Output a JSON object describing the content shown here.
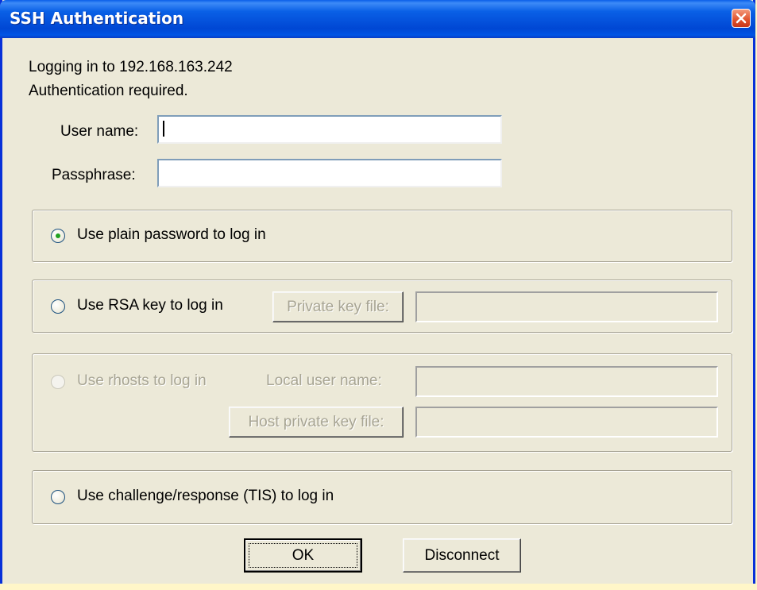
{
  "window": {
    "title": "SSH Authentication",
    "close_icon": "close-icon"
  },
  "info": {
    "line1": "Logging in to 192.168.163.242",
    "line2": "Authentication required."
  },
  "fields": {
    "username_label": "User name:",
    "username_value": "",
    "passphrase_label": "Passphrase:",
    "passphrase_value": ""
  },
  "options": {
    "plain_password": {
      "label": "Use plain password to log in",
      "selected": true,
      "enabled": true
    },
    "rsa": {
      "label": "Use RSA key to log in",
      "selected": false,
      "enabled": true,
      "button_label": "Private key file:",
      "file_value": ""
    },
    "rhosts": {
      "label": "Use rhosts to log in",
      "selected": false,
      "enabled": false,
      "local_user_label": "Local user name:",
      "local_user_value": "",
      "host_key_button_label": "Host private key file:",
      "host_key_value": ""
    },
    "tis": {
      "label": "Use challenge/response (TIS) to log in",
      "selected": false,
      "enabled": true
    }
  },
  "buttons": {
    "ok_label": "OK",
    "disconnect_label": "Disconnect"
  },
  "colors": {
    "titlebar": "#0055e5",
    "dialog_bg": "#ece9d8",
    "radio_selected": "#21a121"
  }
}
